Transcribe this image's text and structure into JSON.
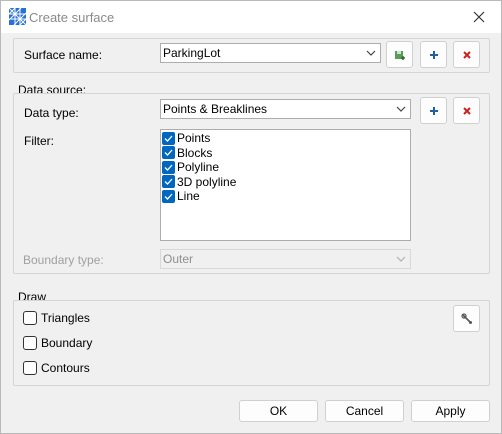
{
  "window": {
    "title": "Create surface"
  },
  "surface": {
    "label": "Surface name:",
    "value": "ParkingLot"
  },
  "data_source": {
    "group_label": "Data source:",
    "data_type_label": "Data type:",
    "data_type_value": "Points & Breaklines",
    "filter_label": "Filter:",
    "filter_items": [
      {
        "label": "Points",
        "checked": true
      },
      {
        "label": "Blocks",
        "checked": true
      },
      {
        "label": "Polyline",
        "checked": true
      },
      {
        "label": "3D polyline",
        "checked": true
      },
      {
        "label": "Line",
        "checked": true
      }
    ],
    "boundary_label": "Boundary type:",
    "boundary_value": "Outer"
  },
  "draw": {
    "group_label": "Draw",
    "options": [
      {
        "label": "Triangles",
        "checked": false
      },
      {
        "label": "Boundary",
        "checked": false
      },
      {
        "label": "Contours",
        "checked": false
      }
    ]
  },
  "buttons": {
    "ok": "OK",
    "cancel": "Cancel",
    "apply": "Apply"
  },
  "colors": {
    "accent": "#0067c0",
    "add": "#1f5fa8",
    "delete": "#d01f1f",
    "save": "#3f8f3f"
  }
}
